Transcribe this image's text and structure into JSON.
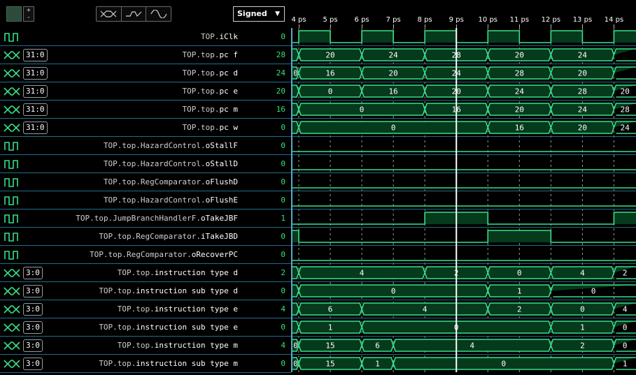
{
  "toolbar": {
    "zoom_plus": "+",
    "zoom_minus": "-",
    "radix_label": "Signed",
    "colors": {
      "accent": "#2ecc71",
      "wave": "#37e08a",
      "bus_fill": "#063a1c",
      "cursor": "#ffffff"
    }
  },
  "timeline": {
    "start_ps": 3.8,
    "end_ps": 14.7,
    "labels": [
      "4 ps",
      "5 ps",
      "6 ps",
      "7 ps",
      "8 ps",
      "9 ps",
      "10 ps",
      "11 ps",
      "12 ps",
      "13 ps",
      "14 ps"
    ],
    "ticks_ps": [
      4,
      5,
      6,
      7,
      8,
      9,
      10,
      11,
      12,
      13,
      14
    ],
    "cursor_ps": 9.0
  },
  "signals": [
    {
      "kind": "bit",
      "width": "",
      "prefix": "TOP.",
      "name": "iClk",
      "value": "0",
      "segments": [
        [
          3.8,
          4.0,
          0
        ],
        [
          4.0,
          5.0,
          1
        ],
        [
          5.0,
          6.0,
          0
        ],
        [
          6.0,
          7.0,
          1
        ],
        [
          7.0,
          8.0,
          0
        ],
        [
          8.0,
          9.0,
          1
        ],
        [
          9.0,
          10.0,
          0
        ],
        [
          10.0,
          11.0,
          1
        ],
        [
          11.0,
          12.0,
          0
        ],
        [
          12.0,
          13.0,
          1
        ],
        [
          13.0,
          14.0,
          0
        ],
        [
          14.0,
          14.7,
          1
        ]
      ]
    },
    {
      "kind": "bus",
      "width": "31:0",
      "prefix": "TOP.top.",
      "name": "pc f",
      "value": "28",
      "segments": [
        [
          3.8,
          4.0,
          ""
        ],
        [
          4.0,
          6.0,
          "20"
        ],
        [
          6.0,
          8.0,
          "24"
        ],
        [
          8.0,
          10.0,
          "28"
        ],
        [
          10.0,
          12.0,
          "20"
        ],
        [
          12.0,
          14.0,
          "24"
        ],
        [
          14.0,
          14.7,
          ""
        ]
      ]
    },
    {
      "kind": "bus",
      "width": "31:0",
      "prefix": "TOP.top.",
      "name": "pc d",
      "value": "24",
      "segments": [
        [
          3.8,
          4.0,
          "0"
        ],
        [
          4.0,
          6.0,
          "16"
        ],
        [
          6.0,
          8.0,
          "20"
        ],
        [
          8.0,
          10.0,
          "24"
        ],
        [
          10.0,
          12.0,
          "28"
        ],
        [
          12.0,
          14.0,
          "20"
        ],
        [
          14.0,
          14.7,
          ""
        ]
      ]
    },
    {
      "kind": "bus",
      "width": "31:0",
      "prefix": "TOP.top.",
      "name": "pc e",
      "value": "20",
      "segments": [
        [
          3.8,
          4.0,
          ""
        ],
        [
          4.0,
          6.0,
          "0"
        ],
        [
          6.0,
          8.0,
          "16"
        ],
        [
          8.0,
          10.0,
          "20"
        ],
        [
          10.0,
          12.0,
          "24"
        ],
        [
          12.0,
          14.0,
          "28"
        ],
        [
          14.0,
          14.7,
          "20"
        ]
      ]
    },
    {
      "kind": "bus",
      "width": "31:0",
      "prefix": "TOP.top.",
      "name": "pc m",
      "value": "16",
      "segments": [
        [
          3.8,
          4.0,
          ""
        ],
        [
          4.0,
          8.0,
          "0"
        ],
        [
          8.0,
          10.0,
          "16"
        ],
        [
          10.0,
          12.0,
          "20"
        ],
        [
          12.0,
          14.0,
          "24"
        ],
        [
          14.0,
          14.7,
          "28"
        ]
      ]
    },
    {
      "kind": "bus",
      "width": "31:0",
      "prefix": "TOP.top.",
      "name": "pc w",
      "value": "0",
      "segments": [
        [
          3.8,
          4.0,
          ""
        ],
        [
          4.0,
          10.0,
          "0"
        ],
        [
          10.0,
          12.0,
          "16"
        ],
        [
          12.0,
          14.0,
          "20"
        ],
        [
          14.0,
          14.7,
          "24"
        ]
      ]
    },
    {
      "kind": "bit",
      "width": "",
      "prefix": "TOP.top.HazardControl.",
      "name": "oStallF",
      "value": "0",
      "segments": [
        [
          3.8,
          14.7,
          0
        ]
      ]
    },
    {
      "kind": "bit",
      "width": "",
      "prefix": "TOP.top.HazardControl.",
      "name": "oStallD",
      "value": "0",
      "segments": [
        [
          3.8,
          14.7,
          0
        ]
      ]
    },
    {
      "kind": "bit",
      "width": "",
      "prefix": "TOP.top.RegComparator.",
      "name": "oFlushD",
      "value": "0",
      "segments": [
        [
          3.8,
          14.7,
          0
        ]
      ]
    },
    {
      "kind": "bit",
      "width": "",
      "prefix": "TOP.top.HazardControl.",
      "name": "oFlushE",
      "value": "0",
      "segments": [
        [
          3.8,
          14.7,
          0
        ]
      ]
    },
    {
      "kind": "bit",
      "width": "",
      "prefix": "TOP.top.JumpBranchHandlerF.",
      "name": "oTakeJBF",
      "value": "1",
      "segments": [
        [
          3.8,
          8.0,
          0
        ],
        [
          8.0,
          10.0,
          1
        ],
        [
          10.0,
          14.0,
          0
        ],
        [
          14.0,
          14.7,
          1
        ]
      ]
    },
    {
      "kind": "bit",
      "width": "",
      "prefix": "TOP.top.RegComparator.",
      "name": "iTakeJBD",
      "value": "0",
      "segments": [
        [
          3.8,
          4.0,
          1
        ],
        [
          4.0,
          10.0,
          0
        ],
        [
          10.0,
          12.0,
          1
        ],
        [
          12.0,
          14.7,
          0
        ]
      ]
    },
    {
      "kind": "bit",
      "width": "",
      "prefix": "TOP.top.RegComparator.",
      "name": "oRecoverPC",
      "value": "0",
      "segments": [
        [
          3.8,
          14.7,
          0
        ]
      ]
    },
    {
      "kind": "bus",
      "width": "3:0",
      "prefix": "TOP.top.",
      "name": "instruction type d",
      "value": "2",
      "segments": [
        [
          3.8,
          4.0,
          ""
        ],
        [
          4.0,
          8.0,
          "4"
        ],
        [
          8.0,
          10.0,
          "2"
        ],
        [
          10.0,
          12.0,
          "0"
        ],
        [
          12.0,
          14.0,
          "4"
        ],
        [
          14.0,
          14.7,
          "2"
        ]
      ]
    },
    {
      "kind": "bus",
      "width": "3:0",
      "prefix": "TOP.top.",
      "name": "instruction sub type d",
      "value": "0",
      "segments": [
        [
          3.8,
          4.0,
          ""
        ],
        [
          4.0,
          10.0,
          "0"
        ],
        [
          10.0,
          12.0,
          "1"
        ],
        [
          12.0,
          14.7,
          "0"
        ]
      ]
    },
    {
      "kind": "bus",
      "width": "3:0",
      "prefix": "TOP.top.",
      "name": "instruction type e",
      "value": "4",
      "segments": [
        [
          3.8,
          4.0,
          ""
        ],
        [
          4.0,
          6.0,
          "6"
        ],
        [
          6.0,
          10.0,
          "4"
        ],
        [
          10.0,
          12.0,
          "2"
        ],
        [
          12.0,
          14.0,
          "0"
        ],
        [
          14.0,
          14.7,
          "4"
        ]
      ]
    },
    {
      "kind": "bus",
      "width": "3:0",
      "prefix": "TOP.top.",
      "name": "instruction sub type e",
      "value": "0",
      "segments": [
        [
          3.8,
          4.0,
          ""
        ],
        [
          4.0,
          6.0,
          "1"
        ],
        [
          6.0,
          12.0,
          "0"
        ],
        [
          12.0,
          14.0,
          "1"
        ],
        [
          14.0,
          14.7,
          "0"
        ]
      ]
    },
    {
      "kind": "bus",
      "width": "3:0",
      "prefix": "TOP.top.",
      "name": "instruction type m",
      "value": "4",
      "segments": [
        [
          3.8,
          4.0,
          "0"
        ],
        [
          4.0,
          6.0,
          "15"
        ],
        [
          6.0,
          7.0,
          "6"
        ],
        [
          7.0,
          12.0,
          "4"
        ],
        [
          12.0,
          14.0,
          "2"
        ],
        [
          14.0,
          14.7,
          "0"
        ]
      ]
    },
    {
      "kind": "bus",
      "width": "3:0",
      "prefix": "TOP.top.",
      "name": "instruction sub type m",
      "value": "0",
      "segments": [
        [
          3.8,
          4.0,
          "0"
        ],
        [
          4.0,
          6.0,
          "15"
        ],
        [
          6.0,
          7.0,
          "1"
        ],
        [
          7.0,
          14.0,
          "0"
        ],
        [
          14.0,
          14.7,
          "1"
        ]
      ]
    }
  ]
}
